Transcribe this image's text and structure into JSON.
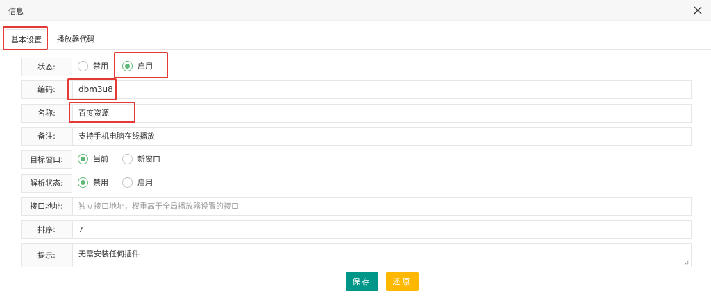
{
  "window": {
    "title": "信息",
    "close_icon": "close-icon"
  },
  "tabs": [
    {
      "label": "基本设置",
      "active": true
    },
    {
      "label": "播放器代码",
      "active": false
    }
  ],
  "form": {
    "status": {
      "label": "状态:",
      "options": [
        "禁用",
        "启用"
      ],
      "selected": "启用"
    },
    "code": {
      "label": "编码:",
      "value": "dbm3u8"
    },
    "name": {
      "label": "名称:",
      "value": "百度资源"
    },
    "remark": {
      "label": "备注:",
      "value": "支持手机电脑在线播放"
    },
    "target": {
      "label": "目标窗口:",
      "options": [
        "当前",
        "新窗口"
      ],
      "selected": "当前"
    },
    "parse": {
      "label": "解析状态:",
      "options": [
        "禁用",
        "启用"
      ],
      "selected": "禁用"
    },
    "api": {
      "label": "接口地址:",
      "value": "",
      "placeholder": "独立接口地址，权重高于全局播放器设置的接口"
    },
    "sort": {
      "label": "排序:",
      "value": "7"
    },
    "tip": {
      "label": "提示:",
      "value": "无需安装任何插件"
    }
  },
  "buttons": {
    "save": "保存",
    "reset": "还原"
  },
  "colors": {
    "accent": "#009688",
    "warm": "#ffb800",
    "radio_checked": "#5fb878",
    "highlight": "#e53935"
  }
}
